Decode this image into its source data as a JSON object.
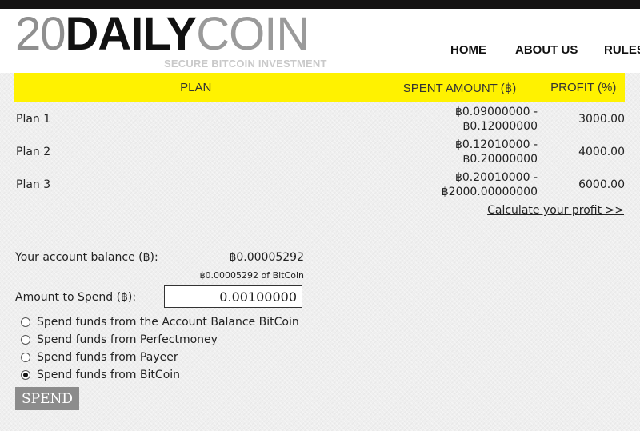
{
  "header": {
    "logo": {
      "number": "20",
      "daily": "DAILY",
      "coin": "COIN"
    },
    "tagline": "SECURE BITCOIN INVESTMENT",
    "nav": [
      {
        "label": "HOME"
      },
      {
        "label": "ABOUT US"
      },
      {
        "label": "RULES"
      }
    ]
  },
  "plans": {
    "columns": [
      "PLAN",
      "SPENT AMOUNT (฿)",
      "PROFIT (%)"
    ],
    "rows": [
      {
        "name": "Plan 1",
        "min": "฿0.09000000 -",
        "max": "฿0.12000000",
        "profit": "3000.00"
      },
      {
        "name": "Plan 2",
        "min": "฿0.12010000 -",
        "max": "฿0.20000000",
        "profit": "4000.00"
      },
      {
        "name": "Plan 3",
        "min": "฿0.20010000 -",
        "max": "฿2000.00000000",
        "profit": "6000.00"
      }
    ],
    "calculate_link": "Calculate your profit >>"
  },
  "form": {
    "balance_label": "Your account balance (฿):",
    "balance_value": "฿0.00005292",
    "balance_sub": "฿0.00005292 of BitCoin",
    "amount_label": "Amount to Spend (฿):",
    "amount_value": "0.00100000",
    "options": [
      {
        "label": "Spend funds from the Account Balance BitCoin",
        "checked": false
      },
      {
        "label": "Spend funds from Perfectmoney",
        "checked": false
      },
      {
        "label": "Spend funds from Payeer",
        "checked": false
      },
      {
        "label": "Spend funds from BitCoin",
        "checked": true
      }
    ],
    "spend_button": "SPEND"
  }
}
